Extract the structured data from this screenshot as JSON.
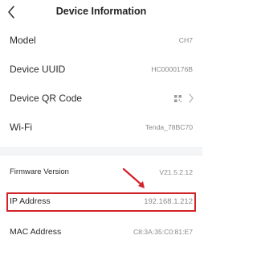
{
  "header": {
    "title": "Device Information",
    "back_icon": "chevron-left-icon"
  },
  "rows": [
    {
      "label": "Model",
      "value": "CH7"
    },
    {
      "label": "Device UUID",
      "value": "HC0000176B"
    },
    {
      "label": "Device QR Code",
      "value": "",
      "icons": [
        "qr-code-icon",
        "chevron-right-icon"
      ]
    },
    {
      "label": "Wi-Fi",
      "value": "Tenda_78BC70"
    },
    {
      "label": "Firmware Version",
      "value": "V21.5.2.12"
    },
    {
      "label": "IP Address",
      "value": "192.168.1.212"
    },
    {
      "label": "MAC Address",
      "value": "C8:3A:35:C0:81:E7"
    }
  ],
  "annotation": {
    "color": "#d2222a",
    "highlighted_row": "IP Address"
  }
}
